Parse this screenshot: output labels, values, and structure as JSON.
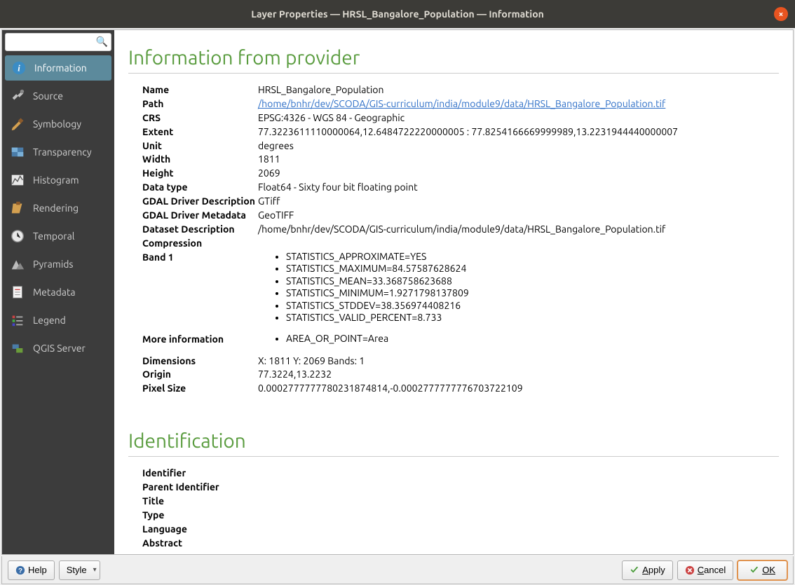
{
  "titlebar": "Layer Properties — HRSL_Bangalore_Population — Information",
  "search": {
    "placeholder": ""
  },
  "sidebar": {
    "items": [
      {
        "label": "Information"
      },
      {
        "label": "Source"
      },
      {
        "label": "Symbology"
      },
      {
        "label": "Transparency"
      },
      {
        "label": "Histogram"
      },
      {
        "label": "Rendering"
      },
      {
        "label": "Temporal"
      },
      {
        "label": "Pyramids"
      },
      {
        "label": "Metadata"
      },
      {
        "label": "Legend"
      },
      {
        "label": "QGIS Server"
      }
    ]
  },
  "section1_title": "Information from provider",
  "info": {
    "name_label": "Name",
    "name_value": "HRSL_Bangalore_Population",
    "path_label": "Path",
    "path_value": "/home/bnhr/dev/SCODA/GIS-curriculum/india/module9/data/HRSL_Bangalore_Population.tif",
    "crs_label": "CRS",
    "crs_value": "EPSG:4326 - WGS 84 - Geographic",
    "extent_label": "Extent",
    "extent_value": "77.3223611110000064,12.6484722220000005 : 77.8254166669999989,13.2231944440000007",
    "unit_label": "Unit",
    "unit_value": "degrees",
    "width_label": "Width",
    "width_value": "1811",
    "height_label": "Height",
    "height_value": "2069",
    "datatype_label": "Data type",
    "datatype_value": "Float64 - Sixty four bit floating point",
    "gdaldesc_label": "GDAL Driver Description",
    "gdaldesc_value": "GTiff",
    "gdalmeta_label": "GDAL Driver Metadata",
    "gdalmeta_value": "GeoTIFF",
    "dsdesc_label": "Dataset Description",
    "dsdesc_value": "/home/bnhr/dev/SCODA/GIS-curriculum/india/module9/data/HRSL_Bangalore_Population.tif",
    "compression_label": "Compression",
    "compression_value": "",
    "band1_label": "Band 1",
    "band1_items": [
      "STATISTICS_APPROXIMATE=YES",
      "STATISTICS_MAXIMUM=84.57587628624",
      "STATISTICS_MEAN=33.368758623688",
      "STATISTICS_MINIMUM=1.9271798137809",
      "STATISTICS_STDDEV=38.356974408216",
      "STATISTICS_VALID_PERCENT=8.733"
    ],
    "moreinfo_label": "More information",
    "moreinfo_items": [
      "AREA_OR_POINT=Area"
    ],
    "dimensions_label": "Dimensions",
    "dimensions_value": "X: 1811 Y: 2069 Bands: 1",
    "origin_label": "Origin",
    "origin_value": "77.3224,13.2232",
    "pixelsize_label": "Pixel Size",
    "pixelsize_value": "0.0002777777780231874814,-0.0002777777776703722109"
  },
  "section2_title": "Identification",
  "ident": {
    "identifier_label": "Identifier",
    "parent_label": "Parent Identifier",
    "title_label": "Title",
    "type_label": "Type",
    "language_label": "Language",
    "abstract_label": "Abstract"
  },
  "footer": {
    "help": "Help",
    "style": "Style",
    "apply": "Apply",
    "cancel": "Cancel",
    "ok": "OK"
  }
}
